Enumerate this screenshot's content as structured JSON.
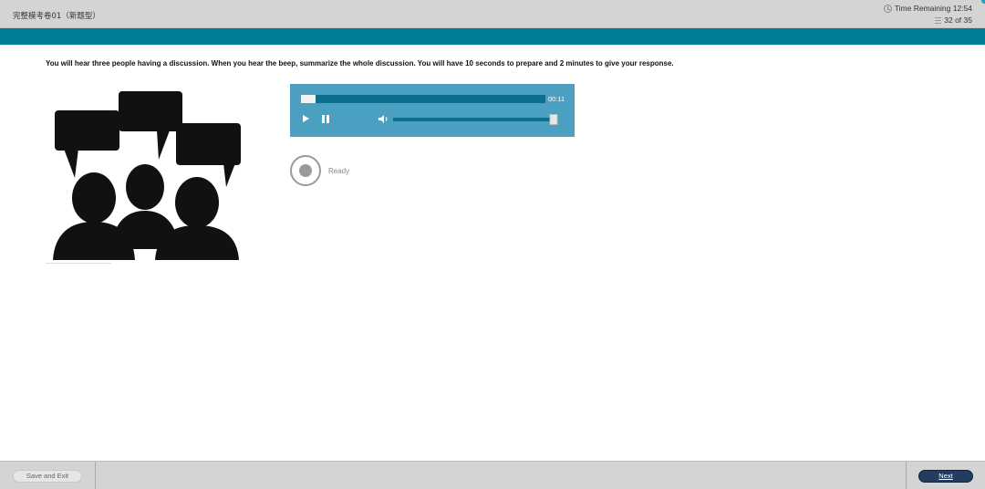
{
  "header": {
    "exam_title": "完整模考卷01（新题型）",
    "time_remaining": "Time Remaining 12:54",
    "question_counter": "32 of 35"
  },
  "instruction": "You will hear three people having a discussion. When you hear the beep, summarize the whole discussion. You will have 10 seconds to prepare and 2 minutes to give your response.",
  "audio_player": {
    "time_display": "00:11",
    "playback_progress": 0.06,
    "volume_level": 0.98,
    "colors": {
      "panel": "#4ba0c2",
      "track": "#0d6f8c"
    }
  },
  "recorder": {
    "status": "Ready"
  },
  "footer": {
    "save_exit_label": "Save and Exit",
    "next_label": "Next"
  },
  "colors": {
    "accent_band": "#007d99",
    "next_button": "#233d60",
    "bar_gray": "#d4d4d4"
  },
  "icons": [
    "clock-icon",
    "list-icon",
    "play-icon",
    "pause-icon",
    "volume-icon",
    "record-icon",
    "discussion-people-illustration"
  ]
}
